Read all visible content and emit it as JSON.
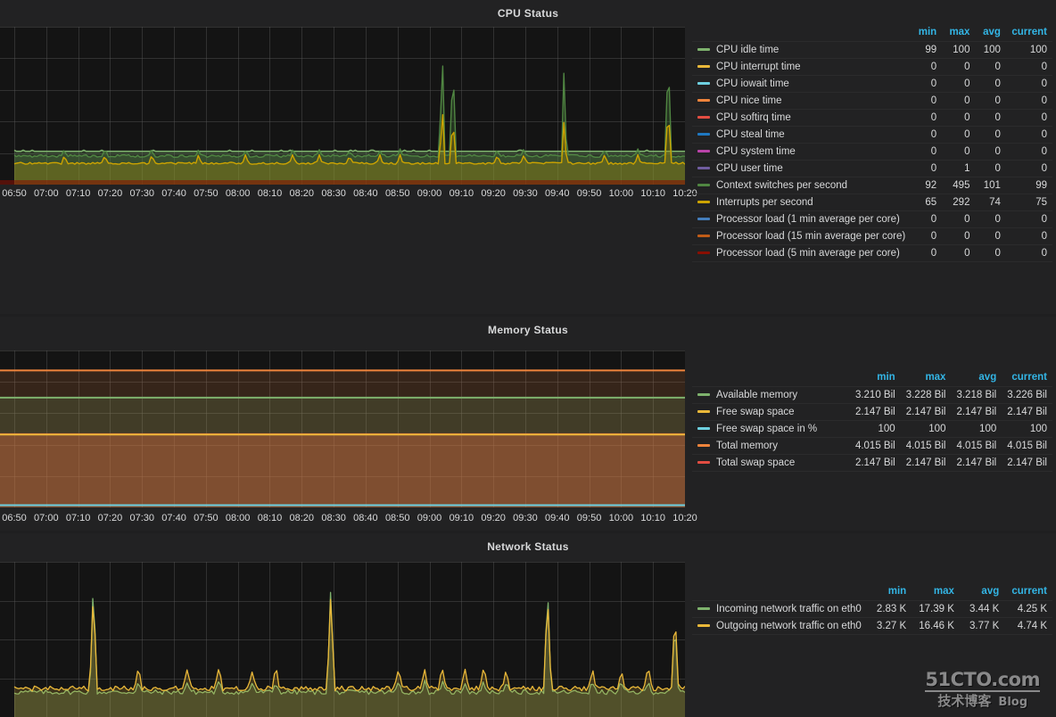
{
  "theme": {
    "page_bg": "#1f1f20",
    "panel_bg": "#222223",
    "graph_bg": "#141414",
    "grid": "#5a5a5a",
    "text": "#d8d9da",
    "header_accent": "#33b5e5"
  },
  "watermark": {
    "top": "51CTO.com",
    "bottom": "技术博客",
    "blog": "Blog"
  },
  "legend_headers": {
    "label": "",
    "min": "min",
    "max": "max",
    "avg": "avg",
    "current": "current"
  },
  "time_axis": {
    "labels": [
      "06:50",
      "07:00",
      "07:10",
      "07:20",
      "07:30",
      "07:40",
      "07:50",
      "08:00",
      "08:10",
      "08:20",
      "08:30",
      "08:40",
      "08:50",
      "09:00",
      "09:10",
      "09:20",
      "09:30",
      "09:40",
      "09:50",
      "10:00",
      "10:10",
      "10:20"
    ],
    "start": "06:50",
    "end": "10:20",
    "step_minutes": 10
  },
  "panels": [
    {
      "id": "cpu-status",
      "title": "CPU Status",
      "series": [
        {
          "name": "CPU idle time",
          "color": "#7eb26d",
          "min": "99",
          "max": "100",
          "avg": "100",
          "current": "100"
        },
        {
          "name": "CPU interrupt time",
          "color": "#eab839",
          "min": "0",
          "max": "0",
          "avg": "0",
          "current": "0"
        },
        {
          "name": "CPU iowait time",
          "color": "#6ed0e0",
          "min": "0",
          "max": "0",
          "avg": "0",
          "current": "0"
        },
        {
          "name": "CPU nice time",
          "color": "#ef843c",
          "min": "0",
          "max": "0",
          "avg": "0",
          "current": "0"
        },
        {
          "name": "CPU softirq time",
          "color": "#e24d42",
          "min": "0",
          "max": "0",
          "avg": "0",
          "current": "0"
        },
        {
          "name": "CPU steal time",
          "color": "#1f78c1",
          "min": "0",
          "max": "0",
          "avg": "0",
          "current": "0"
        },
        {
          "name": "CPU system time",
          "color": "#ba43a9",
          "min": "0",
          "max": "0",
          "avg": "0",
          "current": "0"
        },
        {
          "name": "CPU user time",
          "color": "#705da0",
          "min": "0",
          "max": "1",
          "avg": "0",
          "current": "0"
        },
        {
          "name": "Context switches per second",
          "color": "#508642",
          "min": "92",
          "max": "495",
          "avg": "101",
          "current": "99"
        },
        {
          "name": "Interrupts per second",
          "color": "#cca300",
          "min": "65",
          "max": "292",
          "avg": "74",
          "current": "75"
        },
        {
          "name": "Processor load (1 min average per core)",
          "color": "#447ebc",
          "min": "0",
          "max": "0",
          "avg": "0",
          "current": "0"
        },
        {
          "name": "Processor load (15 min average per core)",
          "color": "#c15c17",
          "min": "0",
          "max": "0",
          "avg": "0",
          "current": "0"
        },
        {
          "name": "Processor load (5 min average per core)",
          "color": "#890f02",
          "min": "0",
          "max": "0",
          "avg": "0",
          "current": "0"
        }
      ]
    },
    {
      "id": "memory-status",
      "title": "Memory Status",
      "series": [
        {
          "name": "Available memory",
          "color": "#7eb26d",
          "min": "3.210 Bil",
          "max": "3.228 Bil",
          "avg": "3.218 Bil",
          "current": "3.226 Bil"
        },
        {
          "name": "Free swap space",
          "color": "#eab839",
          "min": "2.147 Bil",
          "max": "2.147 Bil",
          "avg": "2.147 Bil",
          "current": "2.147 Bil"
        },
        {
          "name": "Free swap space in %",
          "color": "#6ed0e0",
          "min": "100",
          "max": "100",
          "avg": "100",
          "current": "100"
        },
        {
          "name": "Total memory",
          "color": "#ef843c",
          "min": "4.015 Bil",
          "max": "4.015 Bil",
          "avg": "4.015 Bil",
          "current": "4.015 Bil"
        },
        {
          "name": "Total swap space",
          "color": "#e24d42",
          "min": "2.147 Bil",
          "max": "2.147 Bil",
          "avg": "2.147 Bil",
          "current": "2.147 Bil"
        }
      ]
    },
    {
      "id": "network-status",
      "title": "Network Status",
      "series": [
        {
          "name": "Incoming network traffic on eth0",
          "color": "#7eb26d",
          "min": "2.83 K",
          "max": "17.39 K",
          "avg": "3.44 K",
          "current": "4.25 K"
        },
        {
          "name": "Outgoing network traffic on eth0",
          "color": "#eab839",
          "min": "3.27 K",
          "max": "16.46 K",
          "avg": "3.77 K",
          "current": "4.74 K"
        }
      ]
    }
  ],
  "chart_data": [
    {
      "type": "line",
      "title": "CPU Status",
      "xlabel": "",
      "ylabel": "",
      "grid": true,
      "legend_position": "right",
      "x": [
        "06:50",
        "07:00",
        "07:10",
        "07:20",
        "07:30",
        "07:40",
        "07:50",
        "08:00",
        "08:10",
        "08:20",
        "08:30",
        "08:40",
        "08:50",
        "09:00",
        "09:10",
        "09:20",
        "09:30",
        "09:40",
        "09:50",
        "10:00",
        "10:10",
        "10:20"
      ],
      "ylim": [
        0,
        560
      ],
      "series": [
        {
          "name": "CPU idle time",
          "color": "#7eb26d",
          "stat": {
            "min": 99,
            "max": 100,
            "avg": 100,
            "current": 100
          },
          "note": "flat near baseline, scaled small on shared axis"
        },
        {
          "name": "Context switches per second",
          "color": "#508642",
          "stat": {
            "min": 92,
            "max": 495,
            "avg": 101,
            "current": 99
          },
          "note": "flat ~95-105 with tall spikes to ~495 near 09:05, 09:08, 09:47 and 10:19"
        },
        {
          "name": "Interrupts per second",
          "color": "#cca300",
          "stat": {
            "min": 65,
            "max": 292,
            "avg": 74,
            "current": 75
          },
          "note": "flat ~70-80 with spikes to ~292 near 09:05, 09:08, 09:47 and 10:19"
        }
      ]
    },
    {
      "type": "line",
      "title": "Memory Status",
      "xlabel": "",
      "ylabel": "",
      "grid": true,
      "legend_position": "right",
      "x": [
        "06:50",
        "07:00",
        "07:10",
        "07:20",
        "07:30",
        "07:40",
        "07:50",
        "08:00",
        "08:10",
        "08:20",
        "08:30",
        "08:40",
        "08:50",
        "09:00",
        "09:10",
        "09:20",
        "09:30",
        "09:40",
        "09:50",
        "10:00",
        "10:10",
        "10:20"
      ],
      "ylim": [
        0,
        4600000000
      ],
      "series": [
        {
          "name": "Total memory",
          "color": "#ef843c",
          "constant": 4015000000,
          "stat": {
            "min": 4.015,
            "max": 4.015,
            "avg": 4.015,
            "current": 4.015,
            "unit": "Bil"
          }
        },
        {
          "name": "Available memory",
          "color": "#7eb26d",
          "constant": 3218000000,
          "stat": {
            "min": 3.21,
            "max": 3.228,
            "avg": 3.218,
            "current": 3.226,
            "unit": "Bil"
          }
        },
        {
          "name": "Free swap space",
          "color": "#eab839",
          "constant": 2147000000,
          "stat": {
            "min": 2.147,
            "max": 2.147,
            "avg": 2.147,
            "current": 2.147,
            "unit": "Bil"
          }
        },
        {
          "name": "Total swap space",
          "color": "#e24d42",
          "constant": 2147000000,
          "stat": {
            "min": 2.147,
            "max": 2.147,
            "avg": 2.147,
            "current": 2.147,
            "unit": "Bil"
          }
        },
        {
          "name": "Free swap space in %",
          "color": "#6ed0e0",
          "constant": 100,
          "stat": {
            "min": 100,
            "max": 100,
            "avg": 100,
            "current": 100
          }
        }
      ]
    },
    {
      "type": "line",
      "title": "Network Status",
      "xlabel": "",
      "ylabel": "",
      "grid": true,
      "legend_position": "right",
      "x": [
        "06:50",
        "07:00",
        "07:10",
        "07:20",
        "07:30",
        "07:40",
        "07:50",
        "08:00",
        "08:10",
        "08:20",
        "08:30",
        "08:40",
        "08:50",
        "09:00",
        "09:10",
        "09:20",
        "09:30",
        "09:40",
        "09:50",
        "10:00",
        "10:10",
        "10:20"
      ],
      "ylim": [
        0,
        20000
      ],
      "series": [
        {
          "name": "Incoming network traffic on eth0",
          "color": "#7eb26d",
          "stat": {
            "min": 2830,
            "max": 17390,
            "avg": 3440,
            "current": 4250
          },
          "note": "baseline ~3 K with spikes to ~17.4 K near 07:10 and 09:40"
        },
        {
          "name": "Outgoing network traffic on eth0",
          "color": "#eab839",
          "stat": {
            "min": 3270,
            "max": 16460,
            "avg": 3770,
            "current": 4740
          },
          "note": "baseline ~3.3 K with spikes to ~16.5 K near 07:10 and 09:40"
        }
      ]
    }
  ]
}
